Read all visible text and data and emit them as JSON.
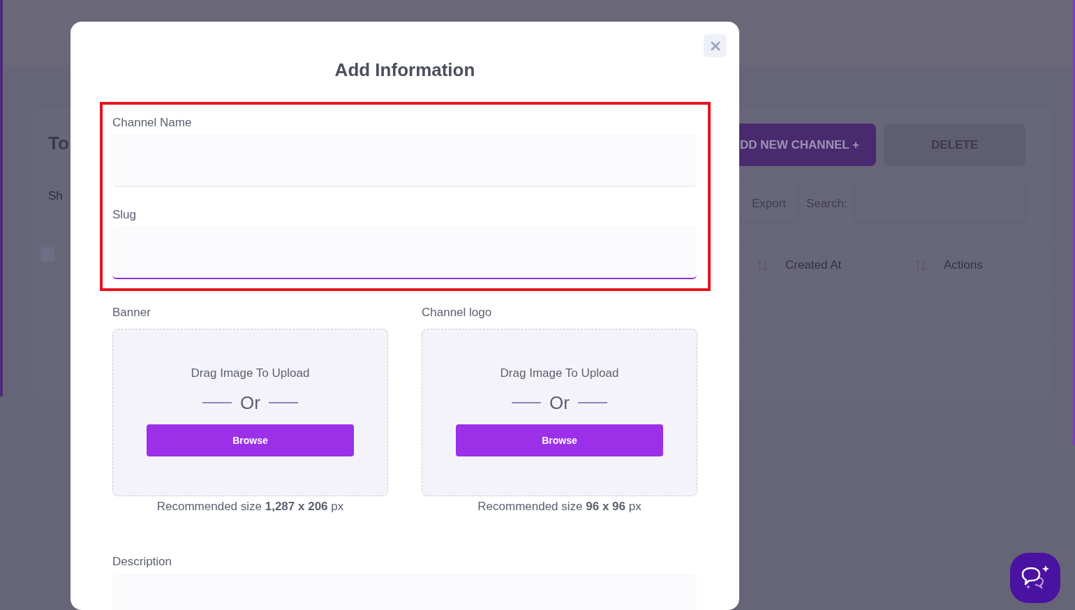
{
  "background": {
    "page_title": "To",
    "show_label": "Sh",
    "select_all": {
      "checked": false
    },
    "add_button": "DD NEW CHANNEL +",
    "delete_button": {
      "label": "DELETE",
      "disabled": true
    },
    "export_button": "Export",
    "search_label": "Search:",
    "columns": [
      {
        "label": "Created At",
        "sortable": true
      },
      {
        "label": "Actions",
        "sortable": false
      }
    ]
  },
  "modal": {
    "title": "Add Information",
    "fields": [
      {
        "label": "Channel Name",
        "focused": false
      },
      {
        "label": "Slug",
        "focused": true
      }
    ],
    "uploads": [
      {
        "label": "Banner",
        "prompt": "Drag Image To Upload",
        "separator": "Or",
        "button": "Browse",
        "hint": "Recommended size **1,287 x 206** px"
      },
      {
        "label": "Channel logo",
        "prompt": "Drag Image To Upload",
        "separator": "Or",
        "button": "Browse",
        "hint": "Recommended size **96 x 96** px"
      }
    ],
    "description": {
      "label": "Description"
    }
  }
}
